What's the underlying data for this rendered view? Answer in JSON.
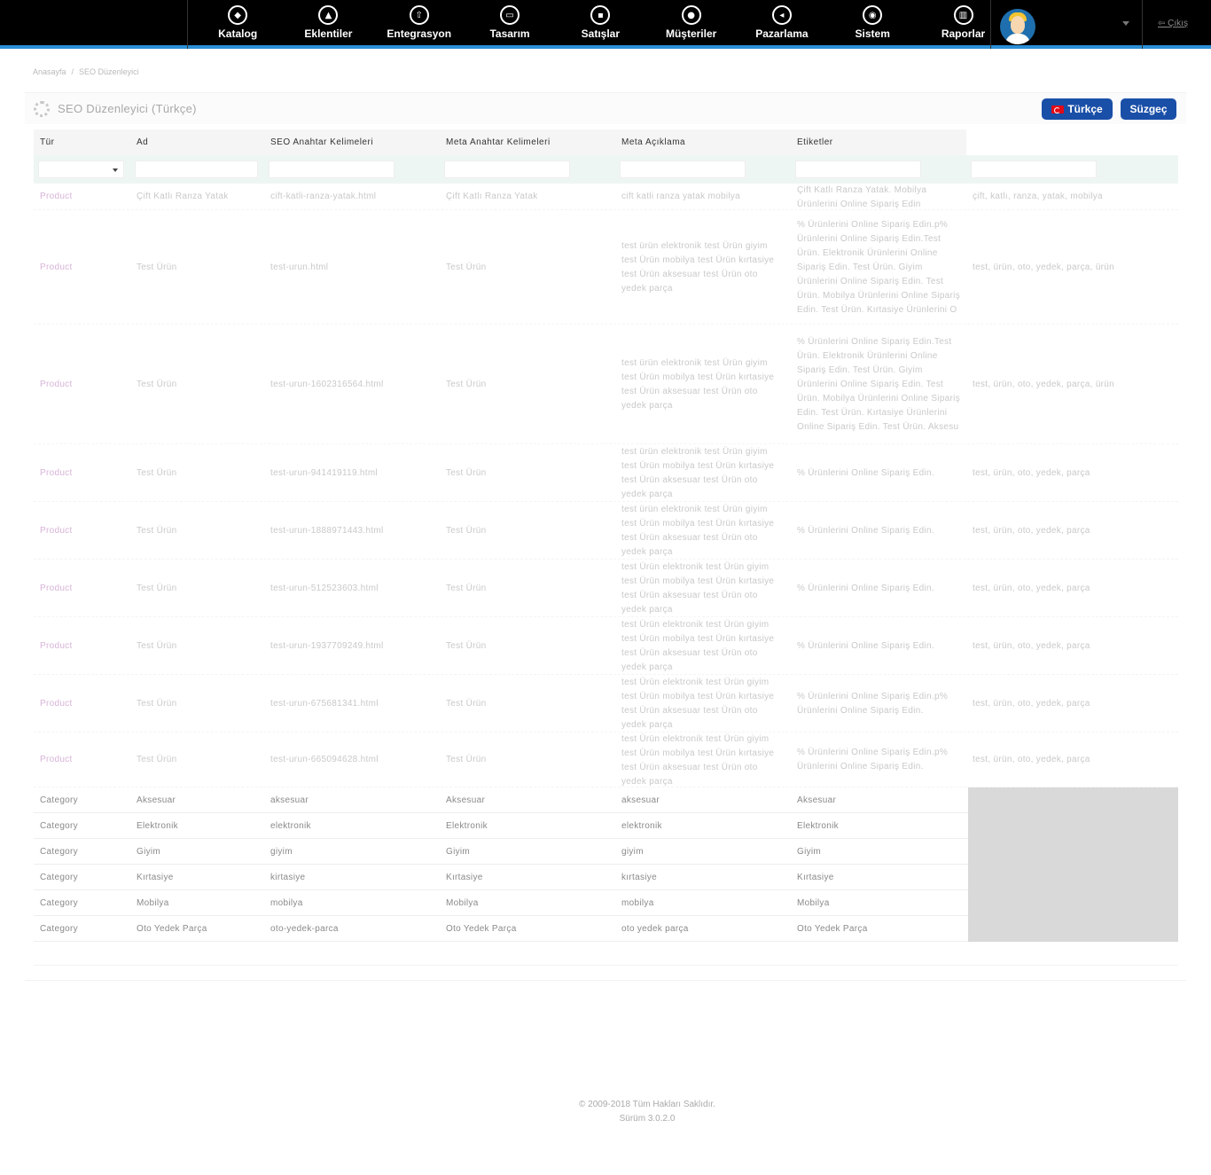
{
  "nav": {
    "items": [
      {
        "label": "Katalog",
        "icon": "tag-icon",
        "glyph": "◆"
      },
      {
        "label": "Eklentiler",
        "icon": "puzzle-icon",
        "glyph": "▲"
      },
      {
        "label": "Entegrasyon",
        "icon": "cloud-upload-icon",
        "glyph": "⇧"
      },
      {
        "label": "Tasarım",
        "icon": "monitor-icon",
        "glyph": "▭"
      },
      {
        "label": "Satışlar",
        "icon": "cart-icon",
        "glyph": "▪"
      },
      {
        "label": "Müşteriler",
        "icon": "user-icon",
        "glyph": "●"
      },
      {
        "label": "Pazarlama",
        "icon": "share-icon",
        "glyph": "◂"
      },
      {
        "label": "Sistem",
        "icon": "gear-icon",
        "glyph": "◉"
      },
      {
        "label": "Raporlar",
        "icon": "chart-icon",
        "glyph": "▥"
      }
    ],
    "logout": "Çıkış"
  },
  "breadcrumb": [
    "Anasayfa",
    "SEO Düzenleyici"
  ],
  "panel": {
    "title": "SEO Düzenleyici (Türkçe)",
    "lang_button": "Türkçe",
    "filter_button": "Süzgeç"
  },
  "table": {
    "headers": [
      "Tür",
      "Ad",
      "SEO Anahtar Kelimeleri",
      "Meta Anahtar Kelimeleri",
      "Meta Açıklama",
      "Etiketler"
    ],
    "rows": [
      {
        "type": "Product",
        "name": "Çift Katlı Ranza Yatak",
        "seo": "cift-katli-ranza-yatak.html",
        "meta_kw": "Çift Katlı Ranza Yatak",
        "meta_desc": "cift katli ranza yatak mobilya",
        "desc2": "Çift Katlı Ranza Yatak. Mobilya Ürünlerini Online Sipariş Edin",
        "tags": "çift, katlı, ranza, yatak, mobilya"
      },
      {
        "type": "Product",
        "name": "Test Ürün",
        "seo": "test-urun.html",
        "meta_kw": "Test Ürün",
        "meta_desc": "test ürün elektronik test Ürün giyim test Ürün mobilya test Ürün kırtasiye test Ürün aksesuar test Ürün oto yedek parça",
        "desc2": "% Ürünlerini Online Sipariş Edin.p% Ürünlerini Online Sipariş Edin.Test Ürün. Elektronik Ürünlerini Online Sipariş Edin. Test Ürün. Giyim Ürünlerini Online Sipariş Edin. Test Ürün. Mobilya Ürünlerini Online Sipariş Edin. Test Ürün. Kırtasiye Ürünlerini O",
        "tags": "test, ürün, oto, yedek, parça, ürün"
      },
      {
        "type": "Product",
        "name": "Test Ürün",
        "seo": "test-urun-1602316564.html",
        "meta_kw": "Test Ürün",
        "meta_desc": "test ürün elektronik test Ürün giyim test Ürün mobilya test Ürün kırtasiye test Ürün aksesuar test Ürün oto yedek parça",
        "desc2": "% Ürünlerini Online Sipariş Edin.Test Ürün. Elektronik Ürünlerini Online Sipariş Edin. Test Ürün. Giyim Ürünlerini Online Sipariş Edin. Test Ürün. Mobilya Ürünlerini Online Sipariş Edin. Test Ürün. Kırtasiye Ürünlerini Online Sipariş Edin. Test Ürün. Aksesu",
        "tags": "test, ürün, oto, yedek, parça, ürün"
      },
      {
        "type": "Product",
        "name": "Test Ürün",
        "seo": "test-urun-941419119.html",
        "meta_kw": "Test Ürün",
        "meta_desc": "test ürün elektronik test Ürün giyim test Ürün mobilya test Ürün kırtasiye test Ürün aksesuar test Ürün oto yedek parça",
        "desc2": "% Ürünlerini Online Sipariş Edin.",
        "tags": "test, ürün, oto, yedek, parça"
      },
      {
        "type": "Product",
        "name": "Test Ürün",
        "seo": "test-urun-1888971443.html",
        "meta_kw": "Test Ürün",
        "meta_desc": "test ürün elektronik test Ürün giyim test Ürün mobilya test Ürün kırtasiye test Ürün aksesuar test Ürün oto yedek parça",
        "desc2": "% Ürünlerini Online Sipariş Edin.",
        "tags": "test, ürün, oto, yedek, parça"
      },
      {
        "type": "Product",
        "name": "Test Ürün",
        "seo": "test-urun-512523603.html",
        "meta_kw": "Test Ürün",
        "meta_desc": "test Ürün elektronik test Ürün giyim test Ürün mobilya test Ürün kırtasiye test Ürün aksesuar test Ürün oto yedek parça",
        "desc2": "% Ürünlerini Online Sipariş Edin.",
        "tags": "test, ürün, oto, yedek, parça"
      },
      {
        "type": "Product",
        "name": "Test Ürün",
        "seo": "test-urun-1937709249.html",
        "meta_kw": "Test Ürün",
        "meta_desc": "test Ürün elektronik test Ürün giyim test Ürün mobilya test Ürün kırtasiye test Ürün aksesuar test Ürün oto yedek parça",
        "desc2": "% Ürünlerini Online Sipariş Edin.",
        "tags": "test, ürün, oto, yedek, parça"
      },
      {
        "type": "Product",
        "name": "Test Ürün",
        "seo": "test-urun-675681341.html",
        "meta_kw": "Test Ürün",
        "meta_desc": "test Ürün elektronik test Ürün giyim test Ürün mobilya test Ürün kırtasiye test Ürün aksesuar test Ürün oto yedek parça",
        "desc2": "% Ürünlerini Online Sipariş Edin.p% Ürünlerini Online Sipariş Edin.",
        "tags": "test, ürün, oto, yedek, parça"
      },
      {
        "type": "Product",
        "name": "Test Ürün",
        "seo": "test-urun-665094628.html",
        "meta_kw": "Test Ürün",
        "meta_desc": "test Ürün elektronik test Ürün giyim test Ürün mobilya test Ürün kırtasiye test Ürün aksesuar test Ürün oto yedek parça",
        "desc2": "% Ürünlerini Online Sipariş Edin.p% Ürünlerini Online Sipariş Edin.",
        "tags": "test, ürün, oto, yedek, parça"
      },
      {
        "type": "Category",
        "name": "Aksesuar",
        "seo": "aksesuar",
        "meta_kw": "Aksesuar",
        "meta_desc": "aksesuar",
        "desc2": "Aksesuar",
        "tags": ""
      },
      {
        "type": "Category",
        "name": "Elektronik",
        "seo": "elektronik",
        "meta_kw": "Elektronik",
        "meta_desc": "elektronik",
        "desc2": "Elektronik",
        "tags": ""
      },
      {
        "type": "Category",
        "name": "Giyim",
        "seo": "giyim",
        "meta_kw": "Giyim",
        "meta_desc": "giyim",
        "desc2": "Giyim",
        "tags": ""
      },
      {
        "type": "Category",
        "name": "Kırtasiye",
        "seo": "kirtasiye",
        "meta_kw": "Kırtasiye",
        "meta_desc": "kırtasiye",
        "desc2": "Kırtasiye",
        "tags": ""
      },
      {
        "type": "Category",
        "name": "Mobilya",
        "seo": "mobilya",
        "meta_kw": "Mobilya",
        "meta_desc": "mobilya",
        "desc2": "Mobilya",
        "tags": ""
      },
      {
        "type": "Category",
        "name": "Oto Yedek Parça",
        "seo": "oto-yedek-parca",
        "meta_kw": "Oto Yedek Parça",
        "meta_desc": "oto yedek parça",
        "desc2": "Oto Yedek Parça",
        "tags": ""
      }
    ]
  },
  "footer": {
    "copyright": "© 2009-2018 Tüm Hakları Saklıdır.",
    "version": "Sürüm 3.0.2.0"
  },
  "colors": {
    "nav_bg": "#000000",
    "nav_accent": "#2b8fd6",
    "button_blue": "#1a4fa8",
    "filter_row_bg": "#eef6f3"
  }
}
